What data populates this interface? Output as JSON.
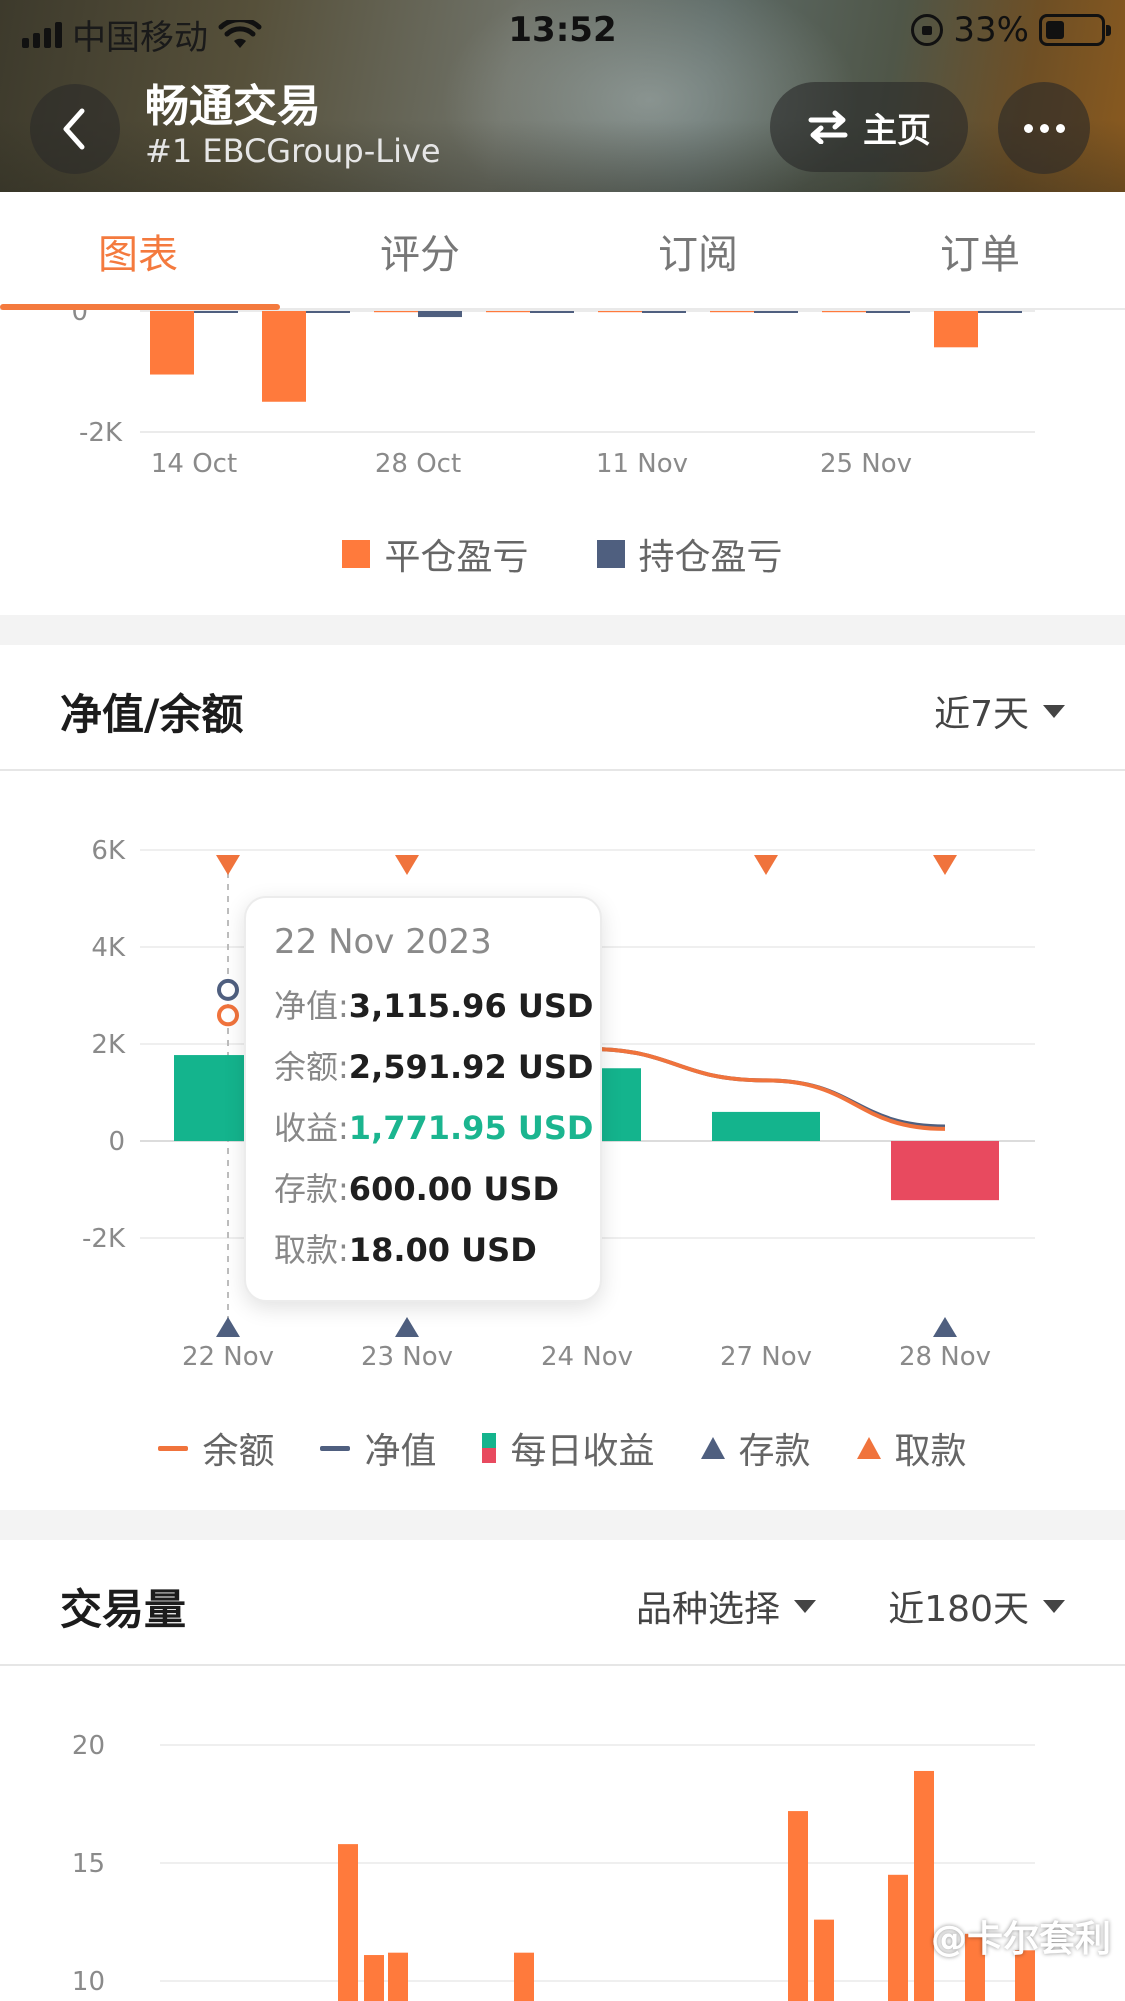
{
  "status": {
    "carrier": "中国移动",
    "time": "13:52",
    "battery": "33%"
  },
  "nav": {
    "title": "畅通交易",
    "subtitle": "#1 EBCGroup-Live",
    "home_label": "主页"
  },
  "tabs": [
    {
      "label": "图表",
      "active": true
    },
    {
      "label": "评分",
      "active": false
    },
    {
      "label": "订阅",
      "active": false
    },
    {
      "label": "订单",
      "active": false
    }
  ],
  "pnl_chart": {
    "legend": [
      "平仓盈亏",
      "持仓盈亏"
    ],
    "colors": {
      "closed": "#ff7a3c",
      "floating": "#4f5f7f"
    }
  },
  "equity_section": {
    "title": "净值/余额",
    "range_label": "近7天"
  },
  "tooltip": {
    "date": "22 Nov 2023",
    "rows": [
      {
        "label": "净值:",
        "value": "3,115.96 USD"
      },
      {
        "label": "余额:",
        "value": "2,591.92 USD"
      },
      {
        "label": "收益:",
        "value": "1,771.95 USD"
      },
      {
        "label": "存款:",
        "value": "600.00 USD"
      },
      {
        "label": "取款:",
        "value": "18.00 USD"
      }
    ]
  },
  "equity_legend": [
    "余额",
    "净值",
    "每日收益",
    "存款",
    "取款"
  ],
  "volume_section": {
    "title": "交易量",
    "symbol_label": "品种选择",
    "range_label": "近180天"
  },
  "watermark": "@卡尔套利",
  "chart_data": [
    {
      "type": "bar",
      "title": "",
      "xlabel": "",
      "ylabel": "",
      "x_ticks": [
        "14 Oct",
        "28 Oct",
        "11 Nov",
        "25 Nov"
      ],
      "y_ticks": [
        "0",
        "-2K"
      ],
      "ylim": [
        -2000,
        0
      ],
      "grid": true,
      "legend_position": "bottom",
      "series": [
        {
          "name": "平仓盈亏",
          "values": [
            -1050,
            -1500,
            -20,
            -20,
            -20,
            -20,
            -20,
            -600
          ],
          "color": "#ff7a3c"
        },
        {
          "name": "持仓盈亏",
          "values": [
            -20,
            -20,
            -100,
            -20,
            -20,
            -20,
            -20,
            -20
          ],
          "color": "#4f5f7f"
        }
      ]
    },
    {
      "type": "bar",
      "title": "",
      "xlabel": "",
      "ylabel": "",
      "categories": [
        "22 Nov",
        "23 Nov",
        "24 Nov",
        "27 Nov",
        "28 Nov"
      ],
      "y_ticks": [
        "6K",
        "4K",
        "2K",
        "0",
        "-2K"
      ],
      "ylim": [
        -2000,
        6000
      ],
      "grid": true,
      "legend_position": "bottom",
      "series": [
        {
          "name": "每日收益",
          "values": [
            1771.95,
            null,
            1500,
            600,
            -1220
          ],
          "colors": {
            "positive": "#14b48d",
            "negative": "#e84a5f"
          }
        },
        {
          "name": "余额",
          "type": "line",
          "values": [
            2591.92,
            null,
            1900,
            1250,
            250
          ],
          "color": "#f0733c"
        },
        {
          "name": "净值",
          "type": "line",
          "values": [
            3115.96,
            null,
            1900,
            1250,
            300
          ],
          "color": "#4f5f7f"
        },
        {
          "name": "存款",
          "type": "marker",
          "markers": [
            "22 Nov",
            "23 Nov",
            "28 Nov"
          ],
          "color": "#4f5f7f"
        },
        {
          "name": "取款",
          "type": "marker",
          "markers": [
            "22 Nov",
            "23 Nov",
            "27 Nov",
            "28 Nov"
          ],
          "color": "#f0733c"
        }
      ]
    },
    {
      "type": "bar",
      "title": "",
      "xlabel": "",
      "ylabel": "",
      "y_ticks": [
        "20",
        "15",
        "10"
      ],
      "ylim": [
        10,
        20
      ],
      "grid": true,
      "series": [
        {
          "name": "",
          "values": [
            15.8,
            11.1,
            11.2,
            11.2,
            17.2,
            12.6,
            14.5,
            18.9,
            12.0,
            11.3
          ],
          "color": "#ff7a3c"
        }
      ]
    }
  ]
}
